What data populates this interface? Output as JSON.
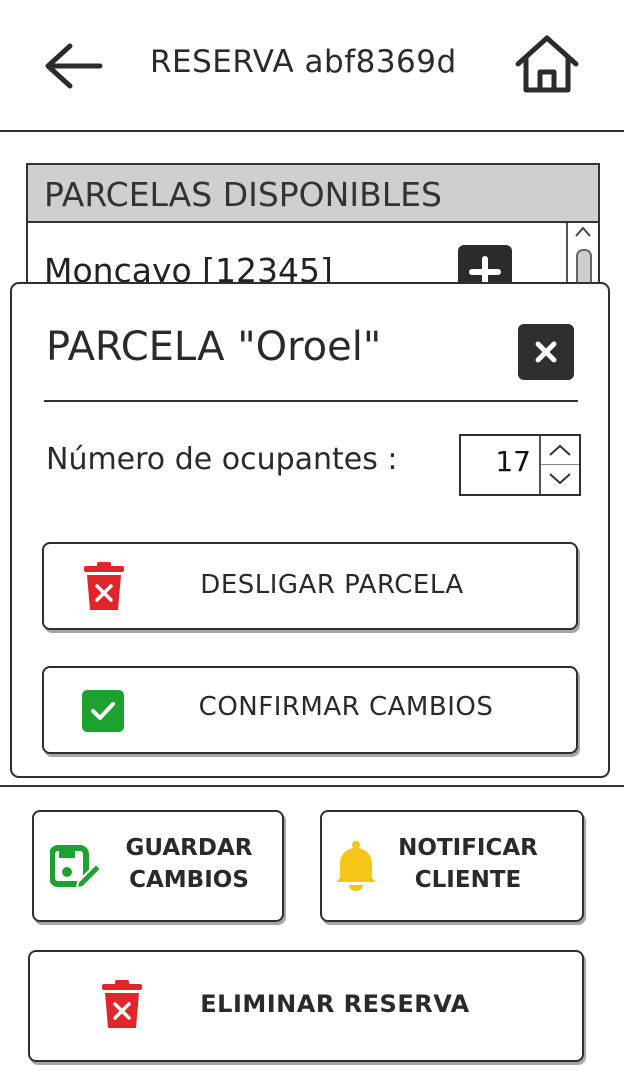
{
  "header": {
    "title": "RESERVA abf8369d",
    "back_icon": "arrow-left-icon",
    "home_icon": "home-icon"
  },
  "available_list": {
    "heading": "PARCELAS DISPONIBLES",
    "rows": [
      {
        "label": "Moncayo   [12345]"
      }
    ]
  },
  "modal": {
    "title": "PARCELA \"Oroel\"",
    "occupants_label": "Número de ocupantes :",
    "occupants_value": "17",
    "unlink_label": "DESLIGAR PARCELA",
    "confirm_label": "CONFIRMAR CAMBIOS"
  },
  "actions": {
    "save_line1": "GUARDAR",
    "save_line2": "CAMBIOS",
    "notify_line1": "NOTIFICAR",
    "notify_line2": "CLIENTE",
    "delete_label": "ELIMINAR RESERVA"
  },
  "colors": {
    "danger": "#e0262b",
    "success": "#1fa12f",
    "warning": "#f5c518",
    "dark": "#2f2f2f",
    "header_fill": "#cfcfcf"
  }
}
